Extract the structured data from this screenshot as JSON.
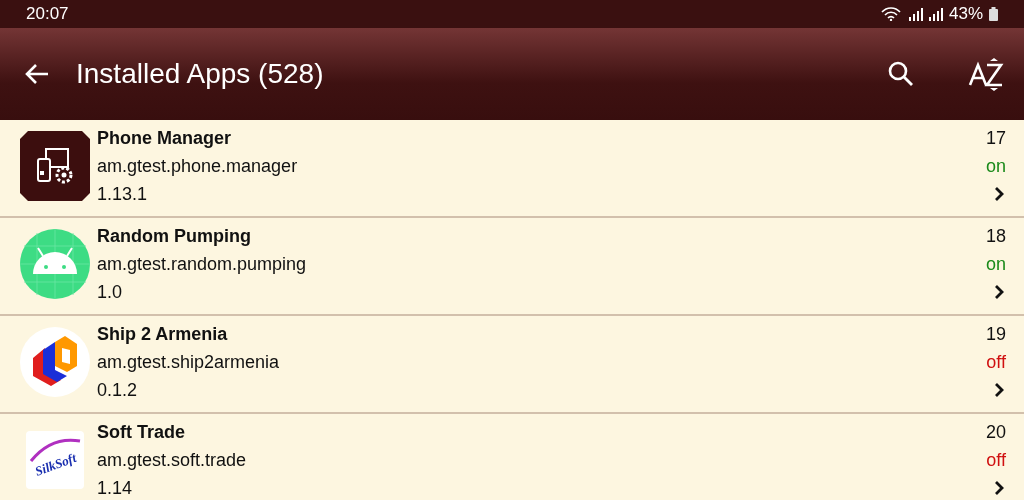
{
  "status_bar": {
    "time": "20:07",
    "battery": "43%"
  },
  "app_bar": {
    "title": "Installed Apps (528)"
  },
  "apps": [
    {
      "name": "Phone Manager",
      "package": "am.gtest.phone.manager",
      "version": "1.13.1",
      "number": "17",
      "status": "on",
      "enabled": true
    },
    {
      "name": "Random Pumping",
      "package": "am.gtest.random.pumping",
      "version": "1.0",
      "number": "18",
      "status": "on",
      "enabled": true
    },
    {
      "name": "Ship 2 Armenia",
      "package": "am.gtest.ship2armenia",
      "version": "0.1.2",
      "number": "19",
      "status": "off",
      "enabled": false
    },
    {
      "name": "Soft Trade",
      "package": "am.gtest.soft.trade",
      "version": "1.14",
      "number": "20",
      "status": "off",
      "enabled": false,
      "logo_text": "SilkSoft"
    }
  ]
}
